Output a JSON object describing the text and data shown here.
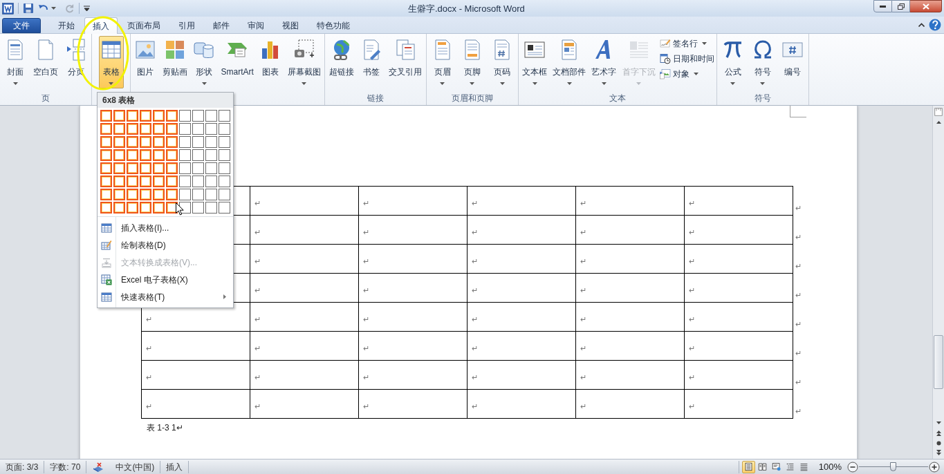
{
  "window": {
    "title": "生僻字.docx - Microsoft Word"
  },
  "tabs": [
    {
      "label": "文件",
      "kind": "file",
      "selected": false
    },
    {
      "label": "开始",
      "kind": "tab",
      "selected": false
    },
    {
      "label": "插入",
      "kind": "tab",
      "selected": true
    },
    {
      "label": "页面布局",
      "kind": "tab",
      "selected": false
    },
    {
      "label": "引用",
      "kind": "tab",
      "selected": false
    },
    {
      "label": "邮件",
      "kind": "tab",
      "selected": false
    },
    {
      "label": "审阅",
      "kind": "tab",
      "selected": false
    },
    {
      "label": "视图",
      "kind": "tab",
      "selected": false
    },
    {
      "label": "特色功能",
      "kind": "tab",
      "selected": false
    }
  ],
  "ribbon": {
    "groups": [
      {
        "label": "页",
        "buttons": [
          {
            "label": "封面",
            "dropdown": true,
            "pressed": false,
            "disabled": false
          },
          {
            "label": "空白页",
            "dropdown": false,
            "pressed": false,
            "disabled": false
          },
          {
            "label": "分页",
            "dropdown": false,
            "pressed": false,
            "disabled": false
          }
        ]
      },
      {
        "buttons": [
          {
            "label": "表格",
            "dropdown": true,
            "pressed": true,
            "disabled": false
          }
        ]
      },
      {
        "buttons": [
          {
            "label": "图片",
            "dropdown": false,
            "pressed": false,
            "disabled": false
          },
          {
            "label": "剪贴画",
            "dropdown": false,
            "pressed": false,
            "disabled": false
          },
          {
            "label": "形状",
            "dropdown": true,
            "pressed": false,
            "disabled": false
          },
          {
            "label": "SmartArt",
            "dropdown": false,
            "pressed": false,
            "disabled": false
          },
          {
            "label": "图表",
            "dropdown": false,
            "pressed": false,
            "disabled": false
          },
          {
            "label": "屏幕截图",
            "dropdown": true,
            "pressed": false,
            "disabled": false
          }
        ]
      },
      {
        "label": "链接",
        "buttons": [
          {
            "label": "超链接",
            "dropdown": false,
            "pressed": false,
            "disabled": false
          },
          {
            "label": "书签",
            "dropdown": false,
            "pressed": false,
            "disabled": false
          },
          {
            "label": "交叉引用",
            "dropdown": false,
            "pressed": false,
            "disabled": false
          }
        ]
      },
      {
        "label": "页眉和页脚",
        "buttons": [
          {
            "label": "页眉",
            "dropdown": true,
            "pressed": false,
            "disabled": false
          },
          {
            "label": "页脚",
            "dropdown": true,
            "pressed": false,
            "disabled": false
          },
          {
            "label": "页码",
            "dropdown": true,
            "pressed": false,
            "disabled": false
          }
        ]
      },
      {
        "label": "文本",
        "buttons": [
          {
            "label": "文本框",
            "dropdown": true,
            "pressed": false,
            "disabled": false
          },
          {
            "label": "文档部件",
            "dropdown": true,
            "pressed": false,
            "disabled": false
          },
          {
            "label": "艺术字",
            "dropdown": true,
            "pressed": false,
            "disabled": false
          },
          {
            "label": "首字下沉",
            "dropdown": true,
            "pressed": false,
            "disabled": true
          }
        ],
        "small_buttons": [
          {
            "label": "签名行",
            "dropdown": true
          },
          {
            "label": "日期和时间",
            "dropdown": false
          },
          {
            "label": "对象",
            "dropdown": true
          }
        ]
      },
      {
        "label": "符号",
        "buttons": [
          {
            "label": "公式",
            "dropdown": true,
            "pressed": false,
            "disabled": false
          },
          {
            "label": "符号",
            "dropdown": true,
            "pressed": false,
            "disabled": false
          },
          {
            "label": "编号",
            "dropdown": false,
            "pressed": false,
            "disabled": false
          }
        ]
      }
    ]
  },
  "table_menu": {
    "title": "6x8 表格",
    "grid": [
      {
        "cells": [
          {
            "selected": true
          },
          {
            "selected": true
          },
          {
            "selected": true
          },
          {
            "selected": true
          },
          {
            "selected": true
          },
          {
            "selected": true
          },
          {
            "selected": false
          },
          {
            "selected": false
          },
          {
            "selected": false
          },
          {
            "selected": false
          }
        ]
      },
      {
        "cells": [
          {
            "selected": true
          },
          {
            "selected": true
          },
          {
            "selected": true
          },
          {
            "selected": true
          },
          {
            "selected": true
          },
          {
            "selected": true
          },
          {
            "selected": false
          },
          {
            "selected": false
          },
          {
            "selected": false
          },
          {
            "selected": false
          }
        ]
      },
      {
        "cells": [
          {
            "selected": true
          },
          {
            "selected": true
          },
          {
            "selected": true
          },
          {
            "selected": true
          },
          {
            "selected": true
          },
          {
            "selected": true
          },
          {
            "selected": false
          },
          {
            "selected": false
          },
          {
            "selected": false
          },
          {
            "selected": false
          }
        ]
      },
      {
        "cells": [
          {
            "selected": true
          },
          {
            "selected": true
          },
          {
            "selected": true
          },
          {
            "selected": true
          },
          {
            "selected": true
          },
          {
            "selected": true
          },
          {
            "selected": false
          },
          {
            "selected": false
          },
          {
            "selected": false
          },
          {
            "selected": false
          }
        ]
      },
      {
        "cells": [
          {
            "selected": true
          },
          {
            "selected": true
          },
          {
            "selected": true
          },
          {
            "selected": true
          },
          {
            "selected": true
          },
          {
            "selected": true
          },
          {
            "selected": false
          },
          {
            "selected": false
          },
          {
            "selected": false
          },
          {
            "selected": false
          }
        ]
      },
      {
        "cells": [
          {
            "selected": true
          },
          {
            "selected": true
          },
          {
            "selected": true
          },
          {
            "selected": true
          },
          {
            "selected": true
          },
          {
            "selected": true
          },
          {
            "selected": false
          },
          {
            "selected": false
          },
          {
            "selected": false
          },
          {
            "selected": false
          }
        ]
      },
      {
        "cells": [
          {
            "selected": true
          },
          {
            "selected": true
          },
          {
            "selected": true
          },
          {
            "selected": true
          },
          {
            "selected": true
          },
          {
            "selected": true
          },
          {
            "selected": false
          },
          {
            "selected": false
          },
          {
            "selected": false
          },
          {
            "selected": false
          }
        ]
      },
      {
        "cells": [
          {
            "selected": true
          },
          {
            "selected": true
          },
          {
            "selected": true
          },
          {
            "selected": true
          },
          {
            "selected": true
          },
          {
            "selected": true
          },
          {
            "selected": false
          },
          {
            "selected": false
          },
          {
            "selected": false
          },
          {
            "selected": false
          }
        ]
      }
    ],
    "items": [
      {
        "label": "插入表格(I)...",
        "disabled": false,
        "submenu": false
      },
      {
        "label": "绘制表格(D)",
        "disabled": false,
        "submenu": false
      },
      {
        "label": "文本转换成表格(V)...",
        "disabled": true,
        "submenu": false
      },
      {
        "label": "Excel 电子表格(X)",
        "disabled": false,
        "submenu": false
      },
      {
        "label": "快速表格(T)",
        "disabled": false,
        "submenu": true
      }
    ]
  },
  "document": {
    "table": {
      "rows": [
        {
          "cells": [
            {},
            {
              "text": "↵"
            },
            {
              "text": "↵"
            },
            {
              "text": "↵"
            },
            {
              "text": "↵"
            },
            {
              "text": "↵"
            }
          ],
          "end_mark": "↵"
        },
        {
          "cells": [
            {},
            {
              "text": "↵"
            },
            {
              "text": "↵"
            },
            {
              "text": "↵"
            },
            {
              "text": "↵"
            },
            {
              "text": "↵"
            }
          ],
          "end_mark": "↵"
        },
        {
          "cells": [
            {},
            {
              "text": "↵"
            },
            {
              "text": "↵"
            },
            {
              "text": "↵"
            },
            {
              "text": "↵"
            },
            {
              "text": "↵"
            }
          ],
          "end_mark": "↵"
        },
        {
          "cells": [
            {},
            {
              "text": "↵"
            },
            {
              "text": "↵"
            },
            {
              "text": "↵"
            },
            {
              "text": "↵"
            },
            {
              "text": "↵"
            }
          ],
          "end_mark": "↵"
        },
        {
          "cells": [
            {
              "text": "↵"
            },
            {
              "text": "↵"
            },
            {
              "text": "↵"
            },
            {
              "text": "↵"
            },
            {
              "text": "↵"
            },
            {
              "text": "↵"
            }
          ],
          "end_mark": "↵"
        },
        {
          "cells": [
            {
              "text": "↵"
            },
            {
              "text": "↵"
            },
            {
              "text": "↵"
            },
            {
              "text": "↵"
            },
            {
              "text": "↵"
            },
            {
              "text": "↵"
            }
          ],
          "end_mark": "↵"
        },
        {
          "cells": [
            {
              "text": "↵"
            },
            {
              "text": "↵"
            },
            {
              "text": "↵"
            },
            {
              "text": "↵"
            },
            {
              "text": "↵"
            },
            {
              "text": "↵"
            }
          ],
          "end_mark": "↵"
        },
        {
          "cells": [
            {
              "text": "↵"
            },
            {
              "text": "↵"
            },
            {
              "text": "↵"
            },
            {
              "text": "↵"
            },
            {
              "text": "↵"
            },
            {
              "text": "↵"
            }
          ],
          "end_mark": "↵"
        }
      ]
    },
    "caption": "表 1-3 1↵"
  },
  "status_bar": {
    "page": "页面: 3/3",
    "words": "字数: 70",
    "language": "中文(中国)",
    "mode": "插入",
    "view_buttons": [
      {
        "selected": true
      },
      {
        "selected": false
      },
      {
        "selected": false
      },
      {
        "selected": false
      },
      {
        "selected": false
      }
    ],
    "zoom": {
      "reading": "100%",
      "level": 0.49
    }
  }
}
